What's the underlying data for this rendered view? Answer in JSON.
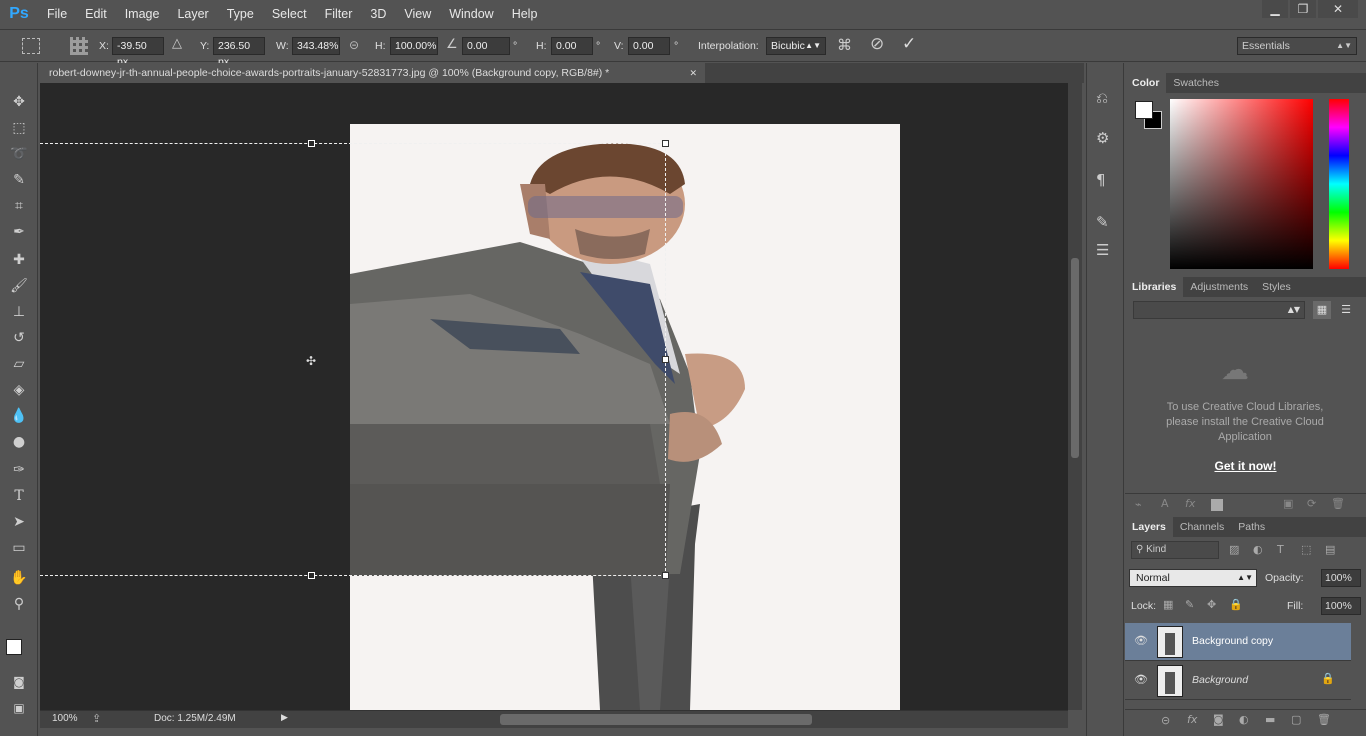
{
  "app": {
    "logo": "Ps"
  },
  "menu": [
    "File",
    "Edit",
    "Image",
    "Layer",
    "Type",
    "Select",
    "Filter",
    "3D",
    "View",
    "Window",
    "Help"
  ],
  "window_controls": {
    "minimize": "▁",
    "restore": "❐",
    "close": "✕"
  },
  "options": {
    "x_label": "X:",
    "x_value": "-39.50 px",
    "y_label": "Y:",
    "y_value": "236.50 px",
    "w_label": "W:",
    "w_value": "343.48%",
    "h_label": "H:",
    "h_value": "100.00%",
    "angle_value": "0.00",
    "angle_unit": "°",
    "hskew_label": "H:",
    "hskew_value": "0.00",
    "hskew_unit": "°",
    "vskew_label": "V:",
    "vskew_value": "0.00",
    "vskew_unit": "°",
    "interp_label": "Interpolation:",
    "interp_value": "Bicubic",
    "workspace": "Essentials"
  },
  "document": {
    "tab_title": "robert-downey-jr-th-annual-people-choice-awards-portraits-january-52831773.jpg @ 100% (Background copy, RGB/8#) *",
    "close": "✕"
  },
  "status": {
    "zoom": "100%",
    "doc": "Doc: 1.25M/2.49M"
  },
  "color_panel": {
    "tabs": [
      "Color",
      "Swatches"
    ]
  },
  "libraries_panel": {
    "tabs": [
      "Libraries",
      "Adjustments",
      "Styles"
    ],
    "message": "To use Creative Cloud Libraries, please install the Creative Cloud Application",
    "link": "Get it now!"
  },
  "layers_panel": {
    "tabs": [
      "Layers",
      "Channels",
      "Paths"
    ],
    "kind": "Kind",
    "blend_mode": "Normal",
    "opacity_label": "Opacity:",
    "opacity": "100%",
    "lock_label": "Lock:",
    "fill_label": "Fill:",
    "fill": "100%",
    "layers": [
      {
        "name": "Background copy",
        "selected": true
      },
      {
        "name": "Background",
        "locked": true
      }
    ]
  },
  "colors": {
    "accent": "#31a8ff",
    "selected_layer": "#6b7f99"
  }
}
